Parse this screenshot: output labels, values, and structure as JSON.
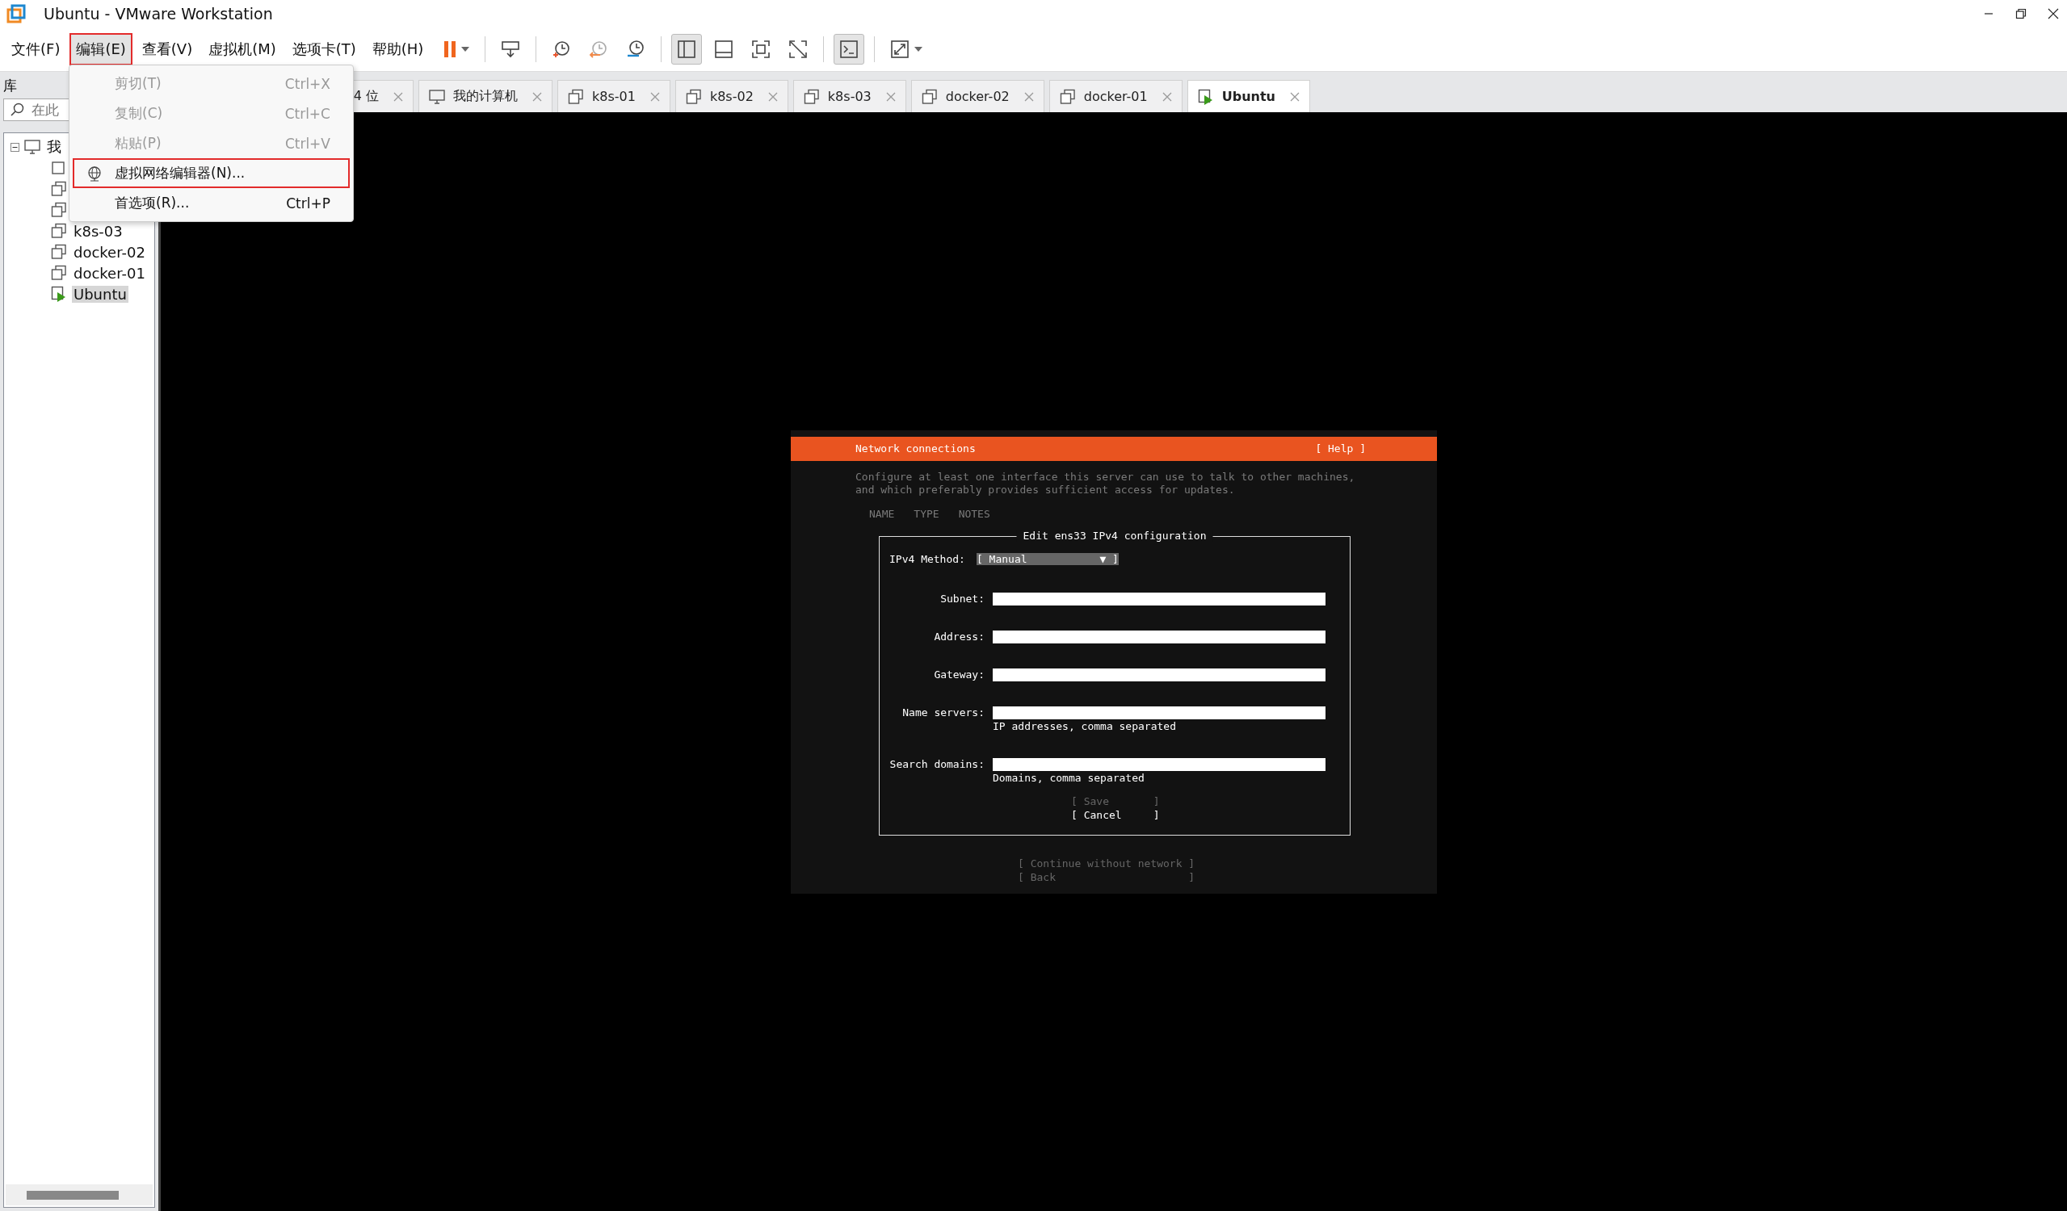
{
  "window": {
    "title": "Ubuntu - VMware Workstation"
  },
  "menu_bar": [
    {
      "label": "文件(F)",
      "highlighted": false
    },
    {
      "label": "编辑(E)",
      "highlighted": true
    },
    {
      "label": "查看(V)",
      "highlighted": false
    },
    {
      "label": "虚拟机(M)",
      "highlighted": false
    },
    {
      "label": "选项卡(T)",
      "highlighted": false
    },
    {
      "label": "帮助(H)",
      "highlighted": false
    }
  ],
  "toolbar": [
    {
      "kind": "pause",
      "selected": false
    },
    {
      "kind": "send-keys",
      "selected": false
    },
    {
      "kind": "snapshot-take",
      "selected": false
    },
    {
      "kind": "snapshot-revert",
      "selected": false
    },
    {
      "kind": "snapshot-manage",
      "selected": false
    },
    {
      "kind": "view-library",
      "selected": true
    },
    {
      "kind": "view-thumbnail",
      "selected": false
    },
    {
      "kind": "view-full",
      "selected": false
    },
    {
      "kind": "view-unity",
      "selected": false
    },
    {
      "kind": "console",
      "selected": true
    },
    {
      "kind": "stretch",
      "selected": false
    }
  ],
  "edit_menu": [
    {
      "label": "剪切(T)",
      "shortcut": "Ctrl+X",
      "disabled": true,
      "highlighted": false,
      "kind": "plain"
    },
    {
      "label": "复制(C)",
      "shortcut": "Ctrl+C",
      "disabled": true,
      "highlighted": false,
      "kind": "plain"
    },
    {
      "label": "粘贴(P)",
      "shortcut": "Ctrl+V",
      "disabled": true,
      "highlighted": false,
      "kind": "plain"
    },
    {
      "label": "虚拟网络编辑器(N)...",
      "disabled": false,
      "highlighted": true,
      "kind": "globe"
    },
    {
      "label": "首选项(R)...",
      "shortcut": "Ctrl+P",
      "disabled": false,
      "highlighted": false,
      "kind": "plain"
    }
  ],
  "sidebar": {
    "title": "库",
    "search": {
      "placeholder": "在此"
    },
    "tree": [
      {
        "label": "我",
        "kind": "computer",
        "expanded": true,
        "selected": false,
        "children": [
          {
            "kind": "vm"
          },
          {
            "kind": "vms"
          },
          {
            "kind": "vms"
          },
          {
            "label": "k8s-03",
            "kind": "vms",
            "selected": false
          },
          {
            "label": "docker-02",
            "kind": "vms",
            "selected": false
          },
          {
            "label": "docker-01",
            "kind": "vms",
            "selected": false
          },
          {
            "label": "Ubuntu",
            "kind": "running",
            "selected": true
          }
        ]
      }
    ]
  },
  "tabs": [
    {
      "label": "4 位",
      "kind": "vms",
      "selected": false
    },
    {
      "label": "我的计算机",
      "kind": "computer",
      "selected": false
    },
    {
      "label": "k8s-01",
      "kind": "vms",
      "selected": false
    },
    {
      "label": "k8s-02",
      "kind": "vms",
      "selected": false
    },
    {
      "label": "k8s-03",
      "kind": "vms",
      "selected": false
    },
    {
      "label": "docker-02",
      "kind": "vms",
      "selected": false
    },
    {
      "label": "docker-01",
      "kind": "vms",
      "selected": false
    },
    {
      "label": "Ubuntu",
      "kind": "running",
      "selected": true
    }
  ],
  "installer": {
    "header": "Network connections",
    "help": "[ Help ]",
    "intro": [
      "Configure at least one interface this server can use to talk to other machines,",
      "and which preferably provides sufficient access for updates."
    ],
    "columns": [
      "NAME",
      "TYPE",
      "NOTES"
    ],
    "dialog": {
      "title": "Edit ens33 IPv4 configuration",
      "method": {
        "label": "IPv4 Method:",
        "value": "[ Manual",
        "caret": "▼ ]"
      },
      "fields": [
        {
          "label": "Subnet:"
        },
        {
          "label": "Address:"
        },
        {
          "label": "Gateway:"
        },
        {
          "label": "Name servers:",
          "hint": "IP addresses, comma separated"
        },
        {
          "label": "Search domains:",
          "hint": "Domains, comma separated"
        }
      ],
      "buttons": [
        {
          "label": "[ Save       ]",
          "disabled": true
        },
        {
          "label": "[ Cancel     ]",
          "disabled": false
        }
      ]
    },
    "buttons": [
      {
        "label": "[ Continue without network ]",
        "disabled": true
      },
      {
        "label": "[ Back                     ]",
        "disabled": true
      }
    ]
  }
}
